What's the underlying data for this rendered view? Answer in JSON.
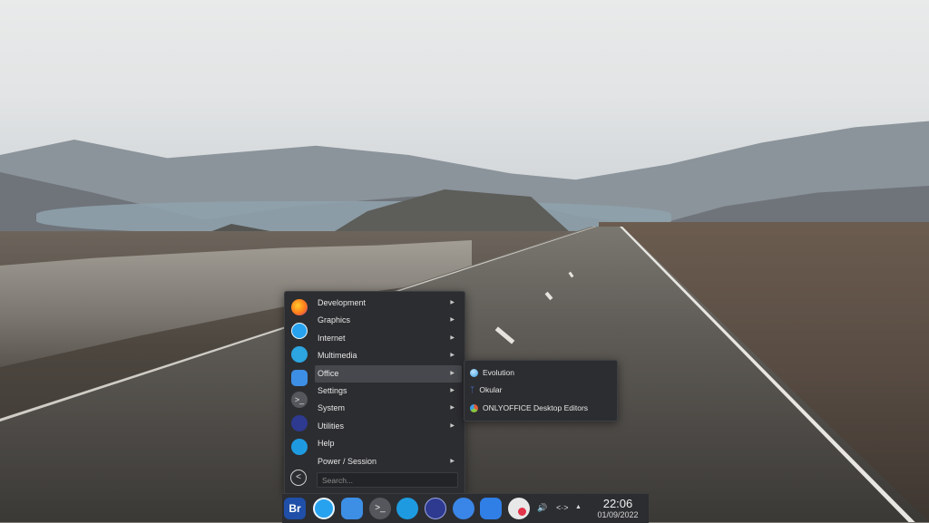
{
  "launcher": {
    "favorites": [
      {
        "icon": "firefox-icon",
        "color": "#ff7a1a"
      },
      {
        "icon": "safari-like-browser-icon",
        "color": "#27a2ef"
      },
      {
        "icon": "telegram-icon",
        "color": "#2ca5e0"
      },
      {
        "icon": "files-icon",
        "color": "#3d8fe6"
      },
      {
        "icon": "terminal-icon",
        "color": "#55575c"
      },
      {
        "icon": "system-monitor-icon",
        "color": "#2e3a8f"
      },
      {
        "icon": "store-icon",
        "color": "#1e9be0"
      }
    ],
    "categories": [
      {
        "label": "Development",
        "has_arrow": true
      },
      {
        "label": "Graphics",
        "has_arrow": true
      },
      {
        "label": "Internet",
        "has_arrow": true
      },
      {
        "label": "Multimedia",
        "has_arrow": true
      },
      {
        "label": "Office",
        "has_arrow": true
      },
      {
        "label": "Settings",
        "has_arrow": true
      },
      {
        "label": "System",
        "has_arrow": true
      },
      {
        "label": "Utilities",
        "has_arrow": true
      },
      {
        "label": "Help",
        "has_arrow": false
      },
      {
        "label": "Power / Session",
        "has_arrow": true
      }
    ],
    "active_category": "Office",
    "arrow_glyph": "▶",
    "back_glyph": "<",
    "search_placeholder": "Search..."
  },
  "office_submenu": {
    "items": [
      {
        "label": "Evolution",
        "icon": "evolution-icon",
        "color": "#3aa0e6"
      },
      {
        "label": "Okular",
        "icon": "okular-icon",
        "color": "#4a7bd8"
      },
      {
        "label": "ONLYOFFICE Desktop Editors",
        "icon": "onlyoffice-icon",
        "color": "#e05a3a"
      }
    ]
  },
  "taskbar": {
    "apps": [
      {
        "icon": "br-launcher-icon",
        "text": "Br",
        "color": "#1f4fa8"
      },
      {
        "icon": "browser-icon",
        "color": "#27a2ef"
      },
      {
        "icon": "files-icon",
        "color": "#3d8fe6"
      },
      {
        "icon": "terminal-icon",
        "color": "#55575c"
      },
      {
        "icon": "store-icon",
        "color": "#1e9be0"
      },
      {
        "icon": "system-monitor-icon",
        "color": "#2e3a8f"
      },
      {
        "icon": "toggle-icon",
        "color": "#3a86e8"
      },
      {
        "icon": "bag-icon",
        "color": "#2f7fe6"
      },
      {
        "icon": "screen-recorder-icon",
        "color": "#e8e8e8"
      }
    ],
    "tray": {
      "volume_glyph": "🔊",
      "network_glyph": "<·>",
      "expand_glyph": "▲"
    },
    "clock": {
      "time": "22:06",
      "date": "01/09/2022"
    }
  }
}
